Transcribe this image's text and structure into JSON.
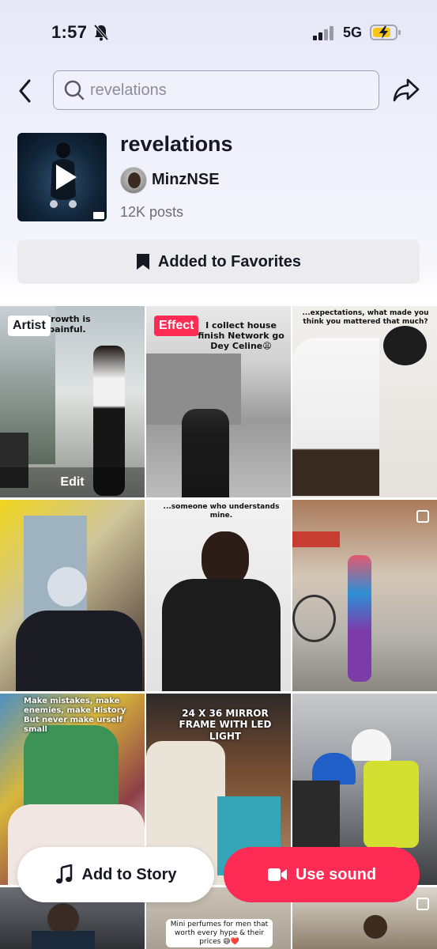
{
  "status_bar": {
    "time": "1:57",
    "network": "5G"
  },
  "search": {
    "placeholder": "revelations"
  },
  "sound": {
    "title": "revelations",
    "artist": "MinzNSE",
    "posts": "12K posts",
    "favorite_label": "Added to Favorites"
  },
  "grid": {
    "artist_badge": "Artist",
    "effect_badge": "Effect",
    "edit_label": "Edit",
    "captions": [
      "Growth is painful.",
      "I collect house finish Network go Dey Celine😩",
      "...expectations, what made you think you mattered that much?",
      "...someone who understands mine.",
      "Make mistakes, make enemies, make History But never make urself small",
      "24 X 36 MIRROR FRAME WITH LED LIGHT",
      "Mini perfumes for men that worth every hype & their prices 😅❤️"
    ]
  },
  "actions": {
    "add_to_story": "Add to Story",
    "use_sound": "Use sound"
  },
  "colors": {
    "accent": "#fe2c55",
    "favorite_bg": "#ececef",
    "text": "#161823"
  },
  "icons": [
    "bell-slash-icon",
    "signal-icon",
    "battery-charging-icon",
    "back-arrow-icon",
    "search-icon",
    "share-icon",
    "play-icon",
    "bookmark-icon",
    "music-note-icon",
    "video-camera-icon"
  ]
}
